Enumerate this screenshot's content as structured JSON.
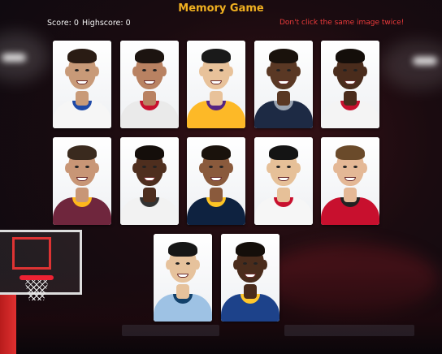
{
  "header": {
    "title": "Memory Game",
    "score_text": "Score: 0",
    "highscore_text": "Highscore: 0",
    "hint": "Don't click the same image twice!"
  },
  "colors": {
    "title": "#f0b020",
    "hint": "#ee3b3b",
    "text": "#f2f2f2"
  },
  "cards": [
    {
      "skin": "#c89a78",
      "hair": "#2a1c14",
      "jersey": "#f6f6f6",
      "collar": "#1f4aa8"
    },
    {
      "skin": "#b98262",
      "hair": "#1c1410",
      "jersey": "#eaeaea",
      "collar": "#c8102e"
    },
    {
      "skin": "#e8c29a",
      "hair": "#1a1a1a",
      "jersey": "#fdb927",
      "collar": "#552583"
    },
    {
      "skin": "#5a3824",
      "hair": "#1a120c",
      "jersey": "#1d2a44",
      "collar": "#9aa4b2"
    },
    {
      "skin": "#4a2c1c",
      "hair": "#140e0a",
      "jersey": "#f4f4f4",
      "collar": "#c8102e"
    },
    {
      "skin": "#c89676",
      "hair": "#3a2a1e",
      "jersey": "#6f263d",
      "collar": "#ffb81c"
    },
    {
      "skin": "#4e2e1e",
      "hair": "#140e0a",
      "jersey": "#f2f2f2",
      "collar": "#333333"
    },
    {
      "skin": "#8a5a3c",
      "hair": "#1a120c",
      "jersey": "#0e2240",
      "collar": "#fec524"
    },
    {
      "skin": "#e6c098",
      "hair": "#141414",
      "jersey": "#f6f6f6",
      "collar": "#c8102e"
    },
    {
      "skin": "#e4b896",
      "hair": "#6a4a2a",
      "jersey": "#c8102e",
      "collar": "#222222"
    },
    {
      "skin": "#e6c29c",
      "hair": "#161616",
      "jersey": "#9ec2e4",
      "collar": "#12416b"
    },
    {
      "skin": "#4a2c1c",
      "hair": "#140e0a",
      "jersey": "#1d428a",
      "collar": "#ffc72c"
    }
  ]
}
